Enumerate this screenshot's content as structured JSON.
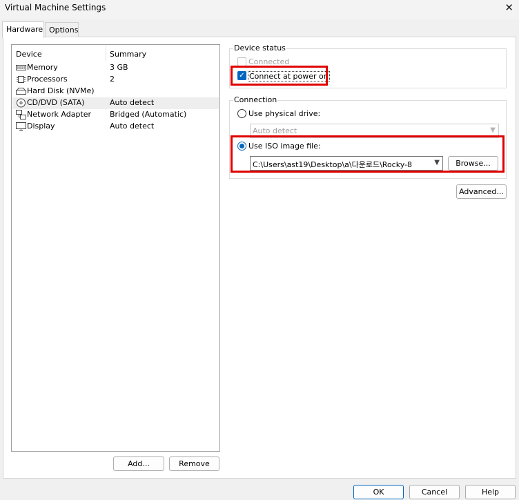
{
  "window": {
    "title": "Virtual Machine Settings"
  },
  "tabs": [
    {
      "label": "Hardware",
      "active": true
    },
    {
      "label": "Options",
      "active": false
    }
  ],
  "device_list": {
    "headers": {
      "device": "Device",
      "summary": "Summary"
    },
    "rows": [
      {
        "name": "Memory",
        "summary": "3 GB",
        "icon": "memory-icon"
      },
      {
        "name": "Processors",
        "summary": "2",
        "icon": "processor-icon"
      },
      {
        "name": "Hard Disk (NVMe)",
        "summary": "",
        "icon": "hard-disk-icon"
      },
      {
        "name": "CD/DVD (SATA)",
        "summary": "Auto detect",
        "icon": "cd-dvd-icon",
        "selected": true
      },
      {
        "name": "Network Adapter",
        "summary": "Bridged (Automatic)",
        "icon": "network-adapter-icon"
      },
      {
        "name": "Display",
        "summary": "Auto detect",
        "icon": "display-icon"
      }
    ]
  },
  "list_buttons": {
    "add": "Add...",
    "remove": "Remove"
  },
  "device_status": {
    "label": "Device status",
    "connected": {
      "label": "Connected",
      "checked": false,
      "enabled": false
    },
    "connect_at_power_on": {
      "label": "Connect at power on",
      "checked": true
    }
  },
  "connection": {
    "label": "Connection",
    "physical": {
      "label": "Use physical drive:",
      "selected": false,
      "value": "Auto detect"
    },
    "iso": {
      "label": "Use ISO image file:",
      "selected": true,
      "path": "C:\\Users\\ast19\\Desktop\\a\\다운로드\\Rocky-8"
    },
    "browse": "Browse..."
  },
  "advanced": "Advanced...",
  "footer": {
    "ok": "OK",
    "cancel": "Cancel",
    "help": "Help"
  },
  "colors": {
    "accent": "#0067c0",
    "highlight": "#e00000"
  }
}
